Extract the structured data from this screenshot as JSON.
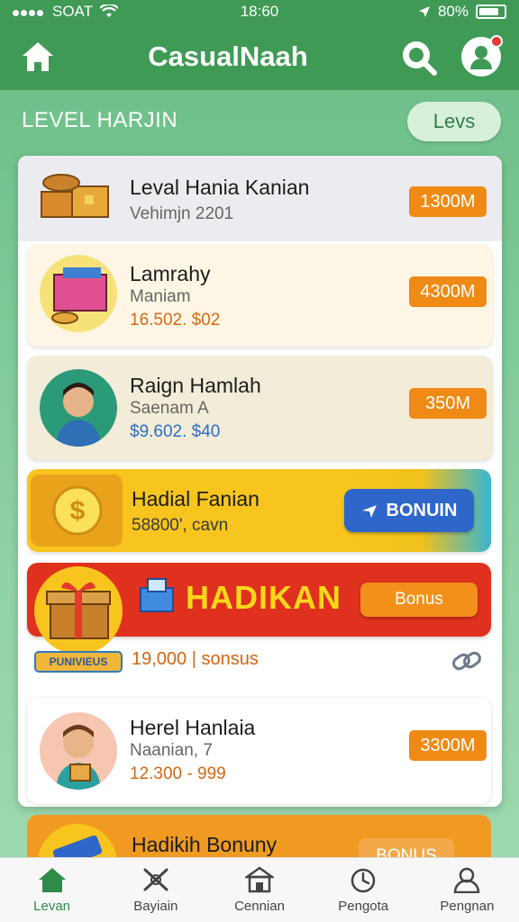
{
  "status": {
    "carrier": "SOAT",
    "time": "18:60",
    "battery": "80%",
    "battery_level": 0.8
  },
  "appbar": {
    "title": "CasualNaah"
  },
  "section": {
    "title": "LEVEL HARJIN",
    "pill": "Levs"
  },
  "items": [
    {
      "title": "Leval Hania Kanian",
      "sub": "Vehimjn 2201",
      "badge": "1300M"
    },
    {
      "title": "Lamrahy",
      "sub": "Maniam",
      "value": "16.502. $02",
      "badge": "4300M"
    },
    {
      "title": "Raign Hamlah",
      "sub": "Saenam A",
      "value": "$9.602. $40",
      "badge": "350M"
    },
    {
      "title": "Hadial Fanian",
      "sub": "58800', cavn",
      "button": "BONUIN"
    },
    {
      "title": "HADIKAN",
      "button": "Bonus",
      "tag": "PUNIVIEUS",
      "value": "19,000 | sonsus"
    },
    {
      "title": "Herel Hanlaia",
      "sub": "Naanian, 7",
      "value": "12.300 - 999",
      "badge": "3300M"
    },
    {
      "title": "Hadikih Bonuny",
      "button": "BONUS"
    }
  ],
  "nav": [
    {
      "label": "Levan",
      "icon": "home-icon"
    },
    {
      "label": "Bayiain",
      "icon": "cross-swords-icon"
    },
    {
      "label": "Cennian",
      "icon": "store-icon"
    },
    {
      "label": "Pengota",
      "icon": "clock-icon"
    },
    {
      "label": "Pengnan",
      "icon": "user-icon"
    }
  ],
  "colors": {
    "primary": "#3f9a56",
    "accent": "#ef8a15",
    "yellow": "#f7c51d",
    "red": "#e0301e",
    "blue": "#2f66c9"
  }
}
